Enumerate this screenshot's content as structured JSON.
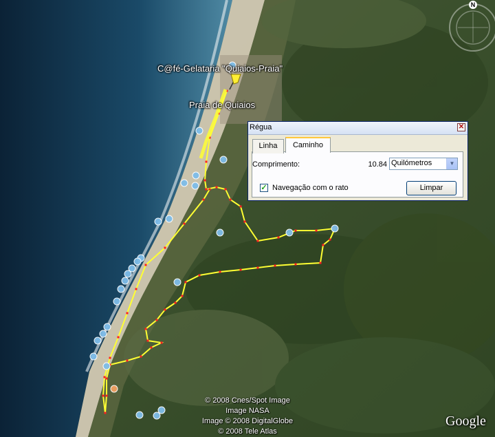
{
  "map": {
    "place_labels": [
      "C@fé-Gelataria \"Quiaios-Praia\"",
      "Praia de Quiaios"
    ],
    "compass": {
      "north_label": "N"
    },
    "copyright_lines": [
      "© 2008 Cnes/Spot Image",
      "Image NASA",
      "Image © 2008 DigitalGlobe",
      "© 2008 Tele Atlas"
    ],
    "logo": "Google",
    "path_color": "#ffff33",
    "path_vertex_color": "#ff2020",
    "placemark_color": "#7fbde9",
    "pin_icon": "yellow-pushpin-icon"
  },
  "ruler_dialog": {
    "title": "Régua",
    "close_icon": "close-x-icon",
    "tabs": [
      {
        "label": "Linha",
        "active": false
      },
      {
        "label": "Caminho",
        "active": true
      }
    ],
    "length_label": "Comprimento:",
    "length_value": "10.84",
    "unit_selected": "Quilómetros",
    "mouse_nav_label": "Navegação com o rato",
    "mouse_nav_checked": true,
    "clear_label": "Limpar"
  }
}
